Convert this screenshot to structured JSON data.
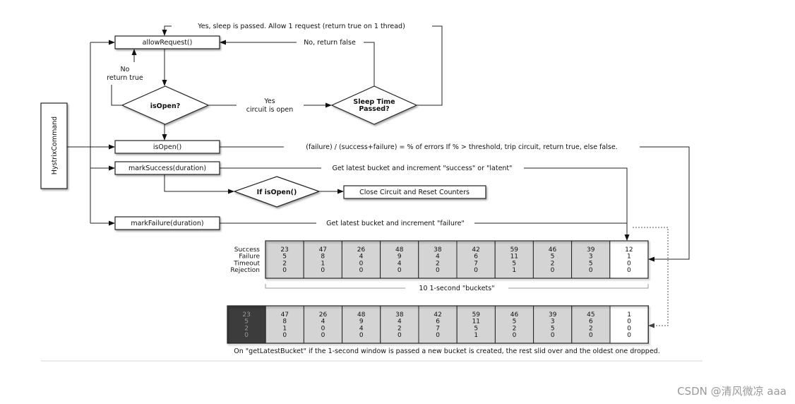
{
  "nodes": {
    "hystrix_command": "HystrixCommand",
    "allow_request": "allowRequest()",
    "is_open_decision": "isOpen?",
    "sleep_decision_line1": "Sleep Time",
    "sleep_decision_line2": "Passed?",
    "is_open_call": "isOpen()",
    "mark_success": "markSuccess(duration)",
    "if_is_open": "If isOpen()",
    "close_circuit": "Close Circuit and Reset Counters",
    "mark_failure": "markFailure(duration)"
  },
  "labels": {
    "sleep_passed": "Yes, sleep is passed.  Allow 1  request (return true on 1 thread)",
    "no_return_false": "No, return false",
    "no": "No",
    "return_true": "return true",
    "yes": "Yes",
    "circuit_is_open": "circuit is open",
    "error_rate": "(failure) / (success+failure) = % of errors   If % > threshold, trip circuit, return true, else false.",
    "increment_success": "Get latest bucket and increment \"success\" or \"latent\"",
    "increment_failure": "Get latest bucket and increment \"failure\"",
    "buckets_caption": "10 1-second \"buckets\"",
    "rolling_caption": "On \"getLatestBucket\" if the 1-second window is passed a new bucket is created, the rest slid over and the oldest one dropped."
  },
  "metric_labels": [
    "Success",
    "Failure",
    "Timeout",
    "Rejection"
  ],
  "buckets_current": [
    [
      23,
      5,
      2,
      0
    ],
    [
      47,
      8,
      1,
      0
    ],
    [
      26,
      4,
      0,
      0
    ],
    [
      48,
      9,
      4,
      0
    ],
    [
      38,
      4,
      2,
      0
    ],
    [
      42,
      6,
      7,
      0
    ],
    [
      59,
      11,
      5,
      1
    ],
    [
      46,
      5,
      2,
      0
    ],
    [
      39,
      3,
      5,
      0
    ],
    [
      12,
      1,
      0,
      0
    ]
  ],
  "buckets_rolled": [
    [
      23,
      5,
      2,
      0
    ],
    [
      47,
      8,
      1,
      0
    ],
    [
      26,
      4,
      0,
      0
    ],
    [
      48,
      9,
      4,
      0
    ],
    [
      38,
      4,
      2,
      0
    ],
    [
      42,
      6,
      7,
      0
    ],
    [
      59,
      11,
      5,
      1
    ],
    [
      46,
      5,
      2,
      0
    ],
    [
      39,
      3,
      5,
      0
    ],
    [
      45,
      6,
      2,
      0
    ],
    [
      1,
      0,
      0,
      0
    ]
  ],
  "colors": {
    "bucket_fill": "#d4d4d4",
    "dropped_bucket": "#3c3c3c",
    "latest_bucket": "#ffffff"
  },
  "watermark": "CSDN @清风微凉 aaa"
}
